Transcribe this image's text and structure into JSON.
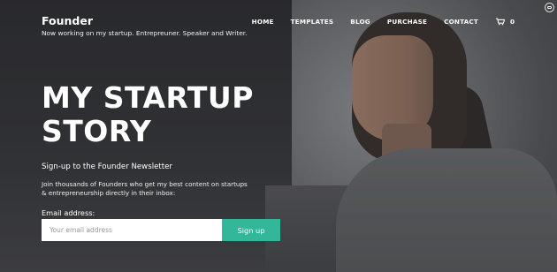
{
  "header": {
    "brand": "Founder",
    "tagline": "Now working on my startup. Entrepreuner. Speaker and Writer."
  },
  "nav": {
    "items": [
      {
        "label": "HOME"
      },
      {
        "label": "TEMPLATES"
      },
      {
        "label": "BLOG"
      },
      {
        "label": "PURCHASE"
      },
      {
        "label": "CONTACT"
      }
    ],
    "cart_count": "0",
    "cart_icon": "shopping-cart-icon"
  },
  "hero": {
    "headline_line1": "MY STARTUP",
    "headline_line2": "STORY",
    "newsletter_title": "Sign-up to the Founder Newsletter",
    "newsletter_desc": "Join thousands of Founders who get my best content on startups & entrepreneurship directly in their inbox:",
    "email_label": "Email address:",
    "email_placeholder": "Your email address",
    "signup_label": "Sign up"
  },
  "colors": {
    "accent": "#32b79b",
    "text": "#ffffff"
  }
}
